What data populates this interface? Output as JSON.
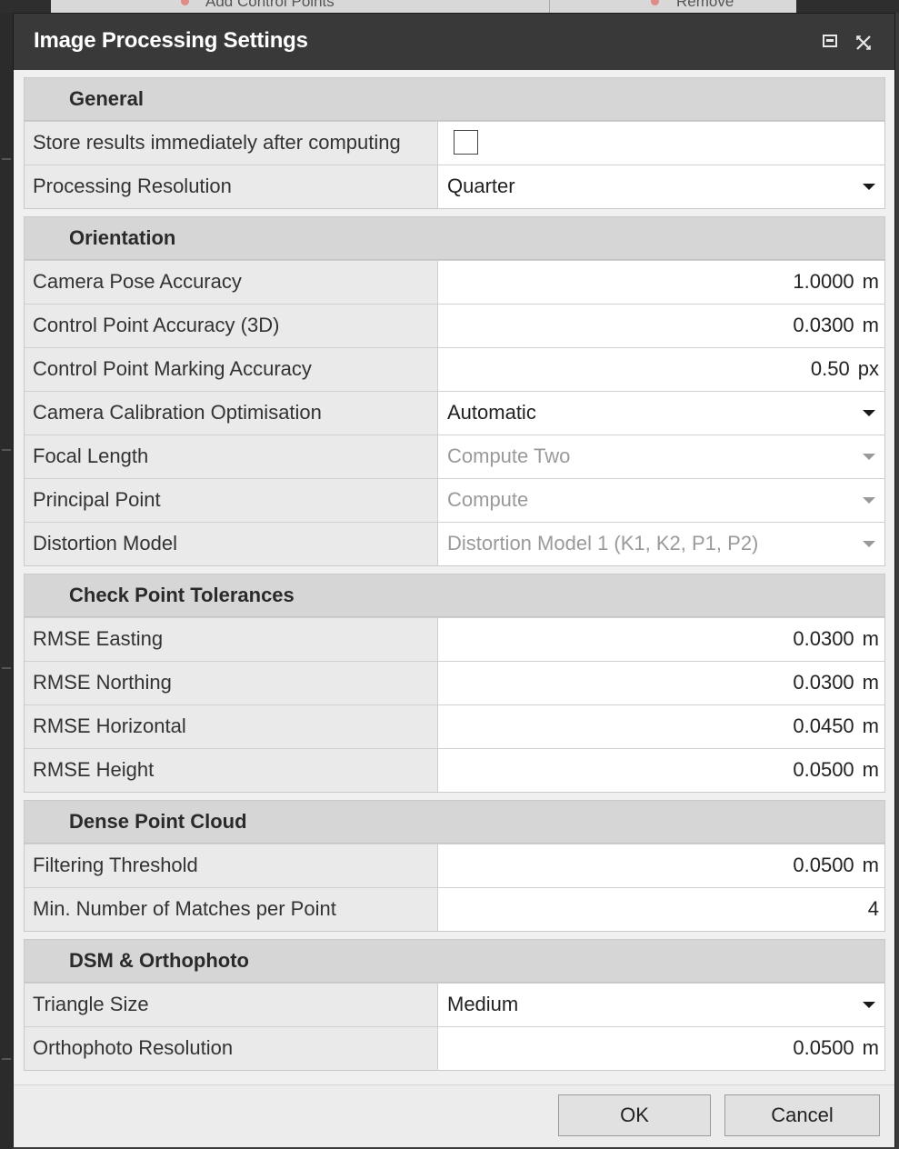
{
  "dialog": {
    "title": "Image Processing Settings"
  },
  "background": {
    "toolbar_left": "Add Control Points",
    "toolbar_right": "Remove"
  },
  "sections": {
    "general": {
      "header": "General",
      "store_results": {
        "label": "Store results immediately after computing",
        "checked": false
      },
      "processing_resolution": {
        "label": "Processing Resolution",
        "value": "Quarter"
      }
    },
    "orientation": {
      "header": "Orientation",
      "camera_pose_accuracy": {
        "label": "Camera Pose Accuracy",
        "value": "1.0000",
        "unit": "m"
      },
      "control_point_accuracy": {
        "label": "Control Point Accuracy (3D)",
        "value": "0.0300",
        "unit": "m"
      },
      "control_point_marking": {
        "label": "Control Point Marking Accuracy",
        "value": "0.50",
        "unit": "px"
      },
      "camera_calibration": {
        "label": "Camera Calibration Optimisation",
        "value": "Automatic"
      },
      "focal_length": {
        "label": "Focal Length",
        "value": "Compute Two"
      },
      "principal_point": {
        "label": "Principal Point",
        "value": "Compute"
      },
      "distortion_model": {
        "label": "Distortion Model",
        "value": "Distortion Model 1 (K1, K2, P1, P2)"
      }
    },
    "check_point": {
      "header": "Check Point Tolerances",
      "rmse_easting": {
        "label": "RMSE Easting",
        "value": "0.0300",
        "unit": "m"
      },
      "rmse_northing": {
        "label": "RMSE Northing",
        "value": "0.0300",
        "unit": "m"
      },
      "rmse_horizontal": {
        "label": "RMSE Horizontal",
        "value": "0.0450",
        "unit": "m"
      },
      "rmse_height": {
        "label": "RMSE Height",
        "value": "0.0500",
        "unit": "m"
      }
    },
    "dense": {
      "header": "Dense Point Cloud",
      "filtering_threshold": {
        "label": "Filtering Threshold",
        "value": "0.0500",
        "unit": "m"
      },
      "min_matches": {
        "label": "Min. Number of Matches per Point",
        "value": "4"
      }
    },
    "dsm": {
      "header": "DSM & Orthophoto",
      "triangle_size": {
        "label": "Triangle Size",
        "value": "Medium"
      },
      "ortho_resolution": {
        "label": "Orthophoto Resolution",
        "value": "0.0500",
        "unit": "m"
      }
    }
  },
  "buttons": {
    "ok": "OK",
    "cancel": "Cancel"
  },
  "colors": {
    "titlebar": "#393939",
    "section_header": "#d6d6d6",
    "disabled_text": "#9a9a9a"
  }
}
